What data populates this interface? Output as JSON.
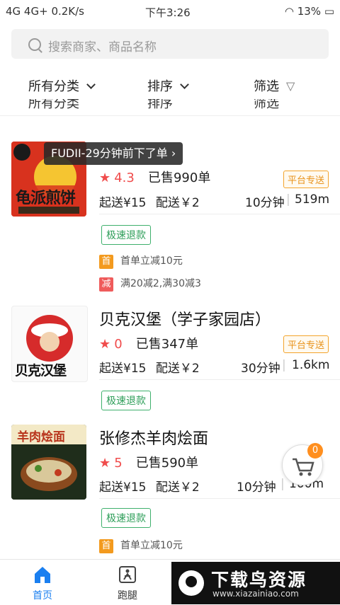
{
  "statusbar": {
    "left": "4G 4G+ 0.2K/s",
    "time": "下午3:26",
    "battery": "13%"
  },
  "search": {
    "placeholder": "搜索商家、商品名称"
  },
  "filters": {
    "category": "所有分类",
    "sort": "排序",
    "screen": "筛选"
  },
  "toast": {
    "text": "FUDII-29分钟前下了单 ›"
  },
  "stores": [
    {
      "name": "",
      "rating": "4.3",
      "sold": "已售990单",
      "min_order": "起送¥15",
      "delivery_fee": "配送￥2",
      "time": "10分钟",
      "distance": "519m",
      "platform_tag": "平台专送",
      "refund": "极速退款",
      "promos": [
        {
          "badge": "首",
          "text": "首单立减10元",
          "color": "#f39a1e"
        },
        {
          "badge": "减",
          "text": "满20减2,满30减3",
          "color": "#ef5b5b"
        }
      ],
      "logo_text": "龟派煎饼"
    },
    {
      "name": "贝克汉堡（学子家园店）",
      "rating": "0",
      "sold": "已售347单",
      "min_order": "起送¥15",
      "delivery_fee": "配送￥2",
      "time": "30分钟",
      "distance": "1.6km",
      "platform_tag": "平台专送",
      "refund": "极速退款",
      "logo_text": "贝克汉堡"
    },
    {
      "name": "张修杰羊肉烩面",
      "rating": "5",
      "sold": "已售590单",
      "min_order": "起送¥15",
      "delivery_fee": "配送￥2",
      "time": "10分钟",
      "distance": "100m",
      "refund": "极速退款",
      "promos": [
        {
          "badge": "首",
          "text": "首单立减10元",
          "color": "#f39a1e"
        }
      ],
      "logo_text": "羊肉烩面"
    }
  ],
  "cart": {
    "count": "0"
  },
  "bottomnav": {
    "home": "首页",
    "errand": "跑腿"
  },
  "watermark": {
    "title": "下载鸟资源",
    "url": "www.xiazainiao.com"
  },
  "colors": {
    "accent": "#1a7ff0",
    "star": "#f04c4c",
    "refund_green": "#2e9e59",
    "platform_orange": "#e8921a"
  }
}
